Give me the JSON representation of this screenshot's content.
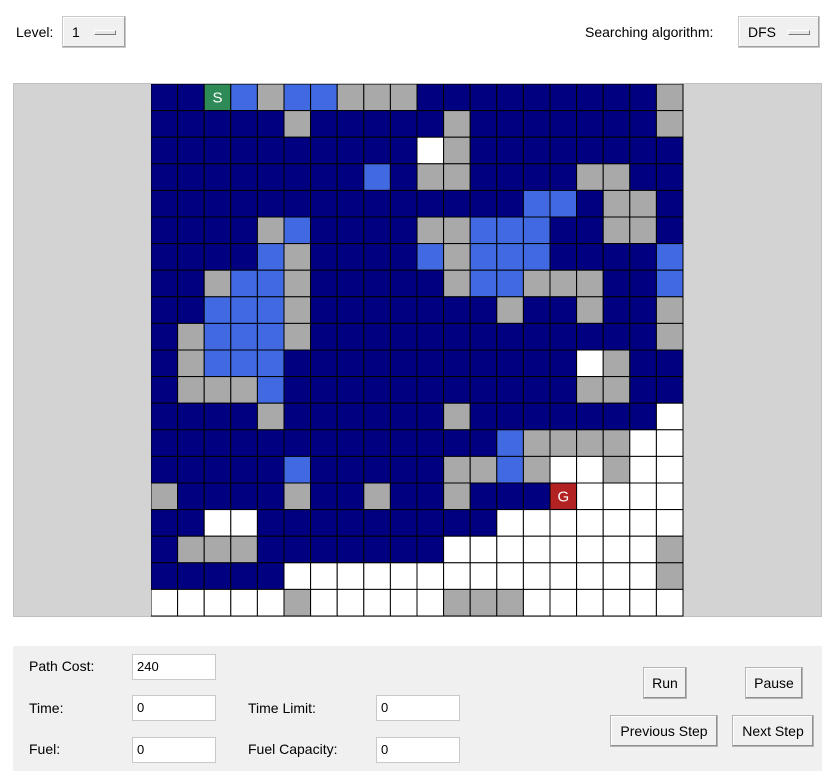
{
  "level": {
    "label": "Level:",
    "value": "1"
  },
  "algorithm": {
    "label": "Searching algorithm:",
    "value": "DFS"
  },
  "grid": {
    "rows": 20,
    "cols": 20,
    "colors": {
      "D": "#000080",
      "L": "#4169e1",
      "G": "#a9a9a9",
      "W": "#ffffff",
      "S": "#2e8b57",
      "R": "#b22222"
    },
    "cells": [
      "DDLLGLLGGGDDDDDDDDDG",
      "DDDDDGDDDDDGDDDDDDDG",
      "DDDDDDDDDDWGDDDDDDDD",
      "DDDDDDDDLDGGDDDDGGDD",
      "DDDDDDDDDDDDDDLLDGGDD",
      "DDDDGLDDDDGGLLLDDGGDD",
      "DDDDLGDDDDLGLLLDDDDL",
      "DDGLLGDDDDDGLLGGGDDL",
      "DDLLLGDDDDDDDGDDGDDG",
      "DGLLLGDDDDDDDDDDDDDG",
      "DGLLLDDDDDDDDDDDWGDD",
      "DGGGLDDDDDDDDDDDGGDD",
      "DDDDGDDDDDDGDDDDDDDW",
      "DDDDDDDDDDDDDLGGGGWW",
      "DDDDDLDDDDDGGLGWWGWW",
      "GDDDDGDDGDDGDDDWWWWW",
      "DDWWDDDDDDDDDWWWWWWW",
      "DGGGDDDDDDDWWWWWWWWG",
      "DDDDDWWWWWWWWWWWWWWG",
      "WWWWWGWWWWWGGGWWWWWW"
    ],
    "start": {
      "row": 0,
      "col": 2,
      "label": "S"
    },
    "goal": {
      "row": 15,
      "col": 15,
      "label": "G"
    }
  },
  "stats": {
    "path_cost": {
      "label": "Path Cost:",
      "value": "240"
    },
    "time": {
      "label": "Time:",
      "value": "0"
    },
    "fuel": {
      "label": "Fuel:",
      "value": "0"
    },
    "time_limit": {
      "label": "Time Limit:",
      "value": "0"
    },
    "fuel_capacity": {
      "label": "Fuel Capacity:",
      "value": "0"
    }
  },
  "buttons": {
    "run": "Run",
    "pause": "Pause",
    "previous_step": "Previous Step",
    "next_step": "Next Step"
  }
}
